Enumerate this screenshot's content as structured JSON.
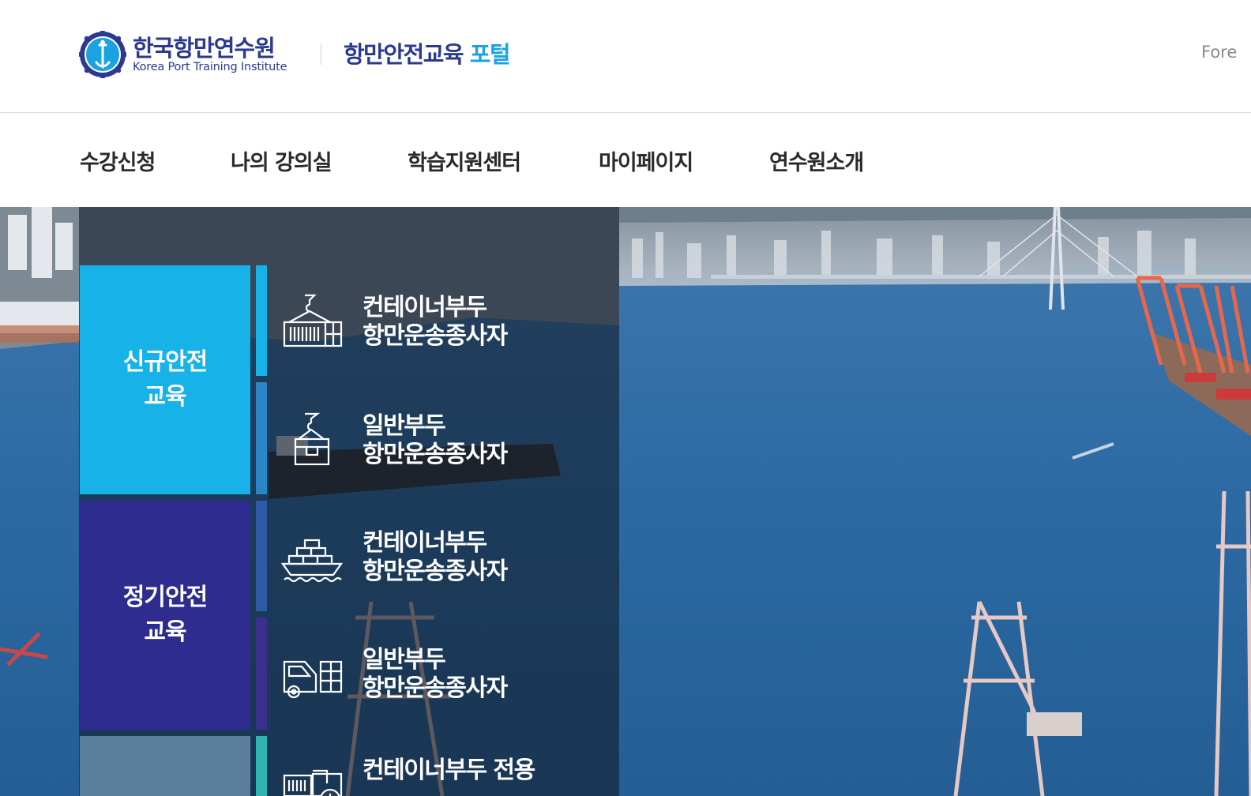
{
  "header": {
    "logo_ko": "한국항만연수원",
    "logo_en": "Korea Port Training Institute",
    "portal_title_main": "항만안전교육",
    "portal_title_accent": "포털",
    "lang_link": "Fore"
  },
  "nav": {
    "items": [
      "수강신청",
      "나의 강의실",
      "학습지원센터",
      "마이페이지",
      "연수원소개"
    ]
  },
  "hero": {
    "categories": [
      {
        "line1": "신규안전",
        "line2": "교육",
        "color": "#16b2e8"
      },
      {
        "line1": "정기안전",
        "line2": "교육",
        "color": "#2e2c8e"
      },
      {
        "line1": "",
        "line2": "",
        "color": "#5b7e9c"
      }
    ],
    "courses": [
      {
        "icon": "container-crane-icon",
        "line1": "컨테이너부두",
        "line2": "항만운송종사자"
      },
      {
        "icon": "cargo-box-crane-icon",
        "line1": "일반부두",
        "line2": "항만운송종사자"
      },
      {
        "icon": "container-ship-icon",
        "line1": "컨테이너부두",
        "line2": "항만운송종사자"
      },
      {
        "icon": "truck-icon",
        "line1": "일반부두",
        "line2": "항만운송종사자"
      },
      {
        "icon": "container-clock-icon",
        "line1": "컨테이너부두 전용",
        "line2": ""
      }
    ],
    "bar_colors": [
      "#16b2e8",
      "#2b86c8",
      "#2e5aa8",
      "#3a2f8f",
      "#2fb5b0"
    ]
  }
}
